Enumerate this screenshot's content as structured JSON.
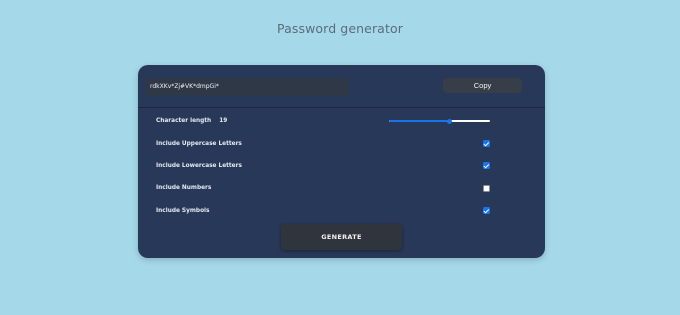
{
  "page": {
    "title": "Password generator",
    "background_color": "#a5d8e8"
  },
  "card": {
    "background_color": "#283859"
  },
  "output": {
    "password": "rdkXKv*Zj#VK*dmpGi*",
    "copy_label": "Copy"
  },
  "settings": {
    "length_label": "Character length",
    "length_value": "19",
    "length_fraction": 0.6,
    "options": [
      {
        "label": "Include Uppercase Letters",
        "checked": true
      },
      {
        "label": "Include Lowercase Letters",
        "checked": true
      },
      {
        "label": "Include Numbers",
        "checked": false
      },
      {
        "label": "Include Symbols",
        "checked": true
      }
    ]
  },
  "generate": {
    "label": "GENERATE"
  },
  "colors": {
    "accent": "#1a73e8"
  }
}
